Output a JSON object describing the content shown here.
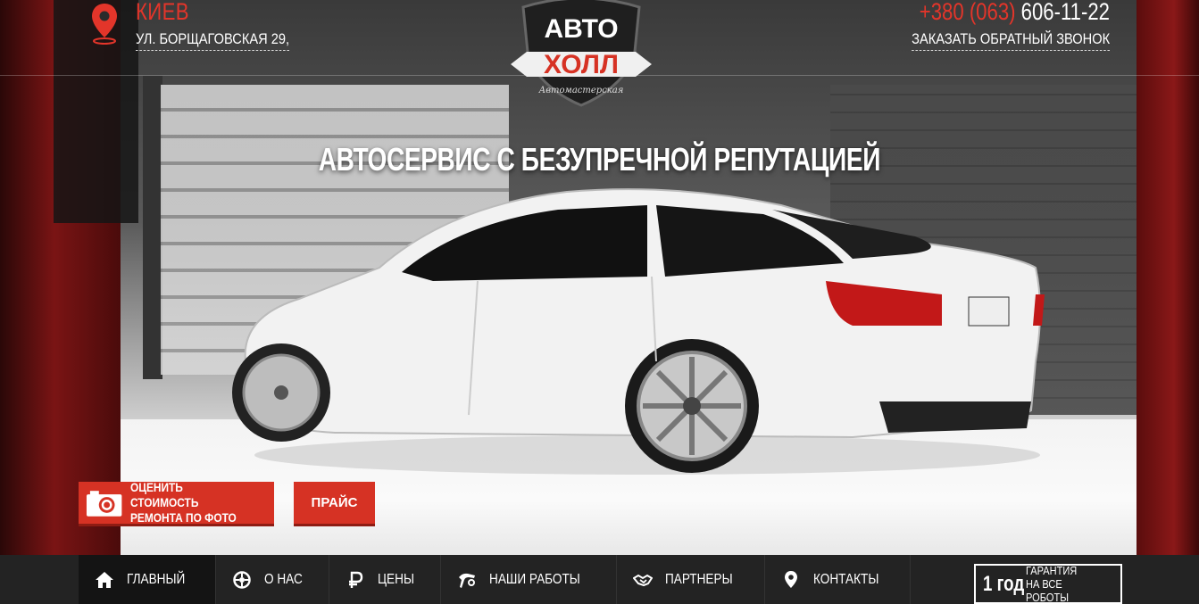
{
  "header": {
    "city": "КИЕВ",
    "address": "УЛ. БОРЩАГОВСКАЯ 29,",
    "phone_code": "+380 (063)",
    "phone_number": "606-11-22",
    "callback_label": "ЗАКАЗАТЬ ОБРАТНЫЙ ЗВОНОК"
  },
  "logo": {
    "line1": "АВТО",
    "line2": "ХОЛЛ",
    "subtitle": "Автомастерская"
  },
  "hero": {
    "tagline": "АВТОСЕРВИС С БЕЗУПРЕЧНОЙ РЕПУТАЦИЕЙ"
  },
  "cta": {
    "photo_estimate_label": "ОЦЕНИТЬ СТОИМОСТЬ\nРЕМОНТА ПО ФОТО",
    "price_label": "ПРАЙС"
  },
  "nav": {
    "items": [
      {
        "label": "ГЛАВНЫЙ",
        "icon": "home-icon",
        "active": true
      },
      {
        "label": "О НАС",
        "icon": "settings-wheel-icon",
        "active": false
      },
      {
        "label": "ЦЕНЫ",
        "icon": "ruble-icon",
        "active": false
      },
      {
        "label": "НАШИ РАБОТЫ",
        "icon": "car-tool-icon",
        "active": false
      },
      {
        "label": "ПАРТНЕРЫ",
        "icon": "handshake-icon",
        "active": false
      },
      {
        "label": "КОНТАКТЫ",
        "icon": "map-pin-icon",
        "active": false
      }
    ]
  },
  "guarantee": {
    "period": "1 год",
    "text": "ГАРАНТИЯ\nНА ВСЕ РОБОТЫ"
  },
  "colors": {
    "accent_red": "#d63224",
    "nav_bg": "#232323",
    "text_white": "#ffffff"
  }
}
